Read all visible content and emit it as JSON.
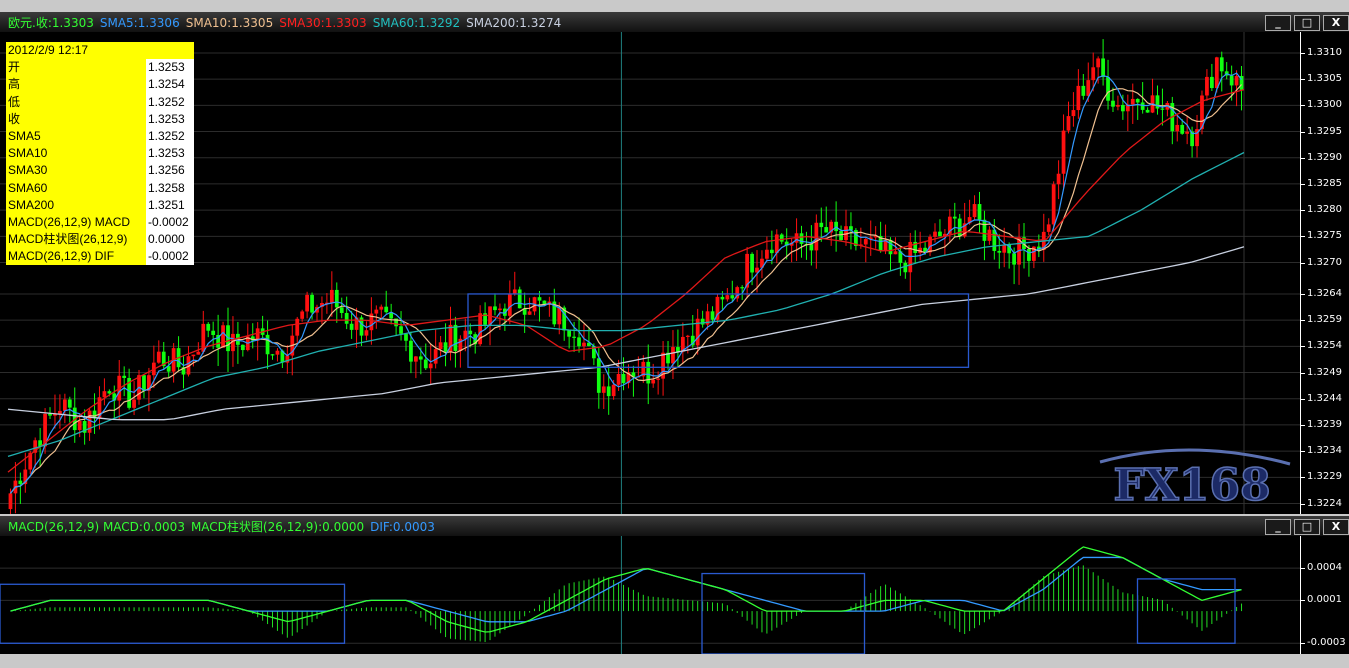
{
  "main_legend": [
    {
      "text": "欧元.收:1.3303",
      "color": "#33ff33"
    },
    {
      "text": "SMA5:1.3306",
      "color": "#3399ff"
    },
    {
      "text": "SMA10:1.3305",
      "color": "#f0c090"
    },
    {
      "text": "SMA30:1.3303",
      "color": "#ff2020"
    },
    {
      "text": "SMA60:1.3292",
      "color": "#20c0c0"
    },
    {
      "text": "SMA200:1.3274",
      "color": "#c8d0e0"
    }
  ],
  "macd_legend": [
    {
      "text": "MACD(26,12,9) MACD:0.0003",
      "color": "#33ff33"
    },
    {
      "text": "MACD柱状图(26,12,9):0.0000",
      "color": "#33ff33"
    },
    {
      "text": "DIF:0.0003",
      "color": "#3399ff"
    }
  ],
  "window_buttons": {
    "minimize": "_",
    "maximize": "□",
    "close": "X"
  },
  "info": {
    "datetime": "2012/2/9 12:17",
    "rows": [
      {
        "label": "开",
        "value": "1.3253"
      },
      {
        "label": "高",
        "value": "1.3254"
      },
      {
        "label": "低",
        "value": "1.3252"
      },
      {
        "label": "收",
        "value": "1.3253"
      },
      {
        "label": "SMA5",
        "value": "1.3252"
      },
      {
        "label": "SMA10",
        "value": "1.3253"
      },
      {
        "label": "SMA30",
        "value": "1.3256"
      },
      {
        "label": "SMA60",
        "value": "1.3258"
      },
      {
        "label": "SMA200",
        "value": "1.3251"
      },
      {
        "label": "MACD(26,12,9) MACD",
        "value": "-0.0002"
      },
      {
        "label": "MACD柱状图(26,12,9)",
        "value": "0.0000"
      },
      {
        "label": "MACD(26,12,9) DIF",
        "value": "-0.0002"
      }
    ]
  },
  "price_axis": [
    "1.3310",
    "1.3305",
    "1.3300",
    "1.3295",
    "1.3290",
    "1.3285",
    "1.3280",
    "1.3275",
    "1.3270",
    "1.3264",
    "1.3259",
    "1.3254",
    "1.3249",
    "1.3244",
    "1.3239",
    "1.3234",
    "1.3229",
    "1.3224"
  ],
  "macd_axis": [
    "0.0004",
    "0.0001",
    "-0.0003"
  ],
  "watermark": "FX168",
  "colors": {
    "up": "#ff1010",
    "down": "#10ff10",
    "sma5": "#3399ff",
    "sma10": "#f0c090",
    "sma30": "#e01818",
    "sma60": "#20b0b0",
    "sma200": "#c8d0e0",
    "box": "#2a5ad0"
  },
  "chart_data": {
    "type": "candlestick",
    "symbol": "欧元",
    "ylim": [
      1.3222,
      1.3314
    ],
    "close_path": [
      1.3226,
      1.3236,
      1.3243,
      1.3239,
      1.3247,
      1.3244,
      1.3252,
      1.325,
      1.3258,
      1.3254,
      1.3256,
      1.3253,
      1.3261,
      1.3263,
      1.3258,
      1.3259,
      1.3255,
      1.3251,
      1.3256,
      1.3257,
      1.3262,
      1.3263,
      1.326,
      1.3258,
      1.3246,
      1.325,
      1.3249,
      1.3255,
      1.3258,
      1.3262,
      1.327,
      1.3275,
      1.3273,
      1.3276,
      1.3274,
      1.3273,
      1.327,
      1.3272,
      1.3276,
      1.3279,
      1.3274,
      1.3272,
      1.3275,
      1.3298,
      1.3308,
      1.33,
      1.3302,
      1.3298,
      1.3295,
      1.3309,
      1.3303
    ],
    "sma200_path": [
      1.3242,
      1.3241,
      1.324,
      1.324,
      1.3242,
      1.3243,
      1.3244,
      1.3245,
      1.3247,
      1.3248,
      1.3249,
      1.325,
      1.3252,
      1.3254,
      1.3256,
      1.3258,
      1.326,
      1.3262,
      1.3263,
      1.3264,
      1.3266,
      1.3268,
      1.327,
      1.3273
    ],
    "sma60_path": [
      1.3233,
      1.3236,
      1.324,
      1.3244,
      1.3248,
      1.325,
      1.3253,
      1.3255,
      1.3257,
      1.3258,
      1.3258,
      1.3257,
      1.3257,
      1.3258,
      1.3259,
      1.3261,
      1.3264,
      1.3268,
      1.3271,
      1.3273,
      1.3274,
      1.3275,
      1.328,
      1.3286,
      1.3291
    ],
    "sma30_path": [
      1.323,
      1.3236,
      1.3242,
      1.3247,
      1.3251,
      1.3254,
      1.3256,
      1.3258,
      1.3259,
      1.3259,
      1.3258,
      1.3259,
      1.326,
      1.3258,
      1.3253,
      1.3254,
      1.3258,
      1.3264,
      1.3271,
      1.3274,
      1.3275,
      1.3274,
      1.3272,
      1.3274,
      1.3276,
      1.3275,
      1.3274,
      1.3283,
      1.3291,
      1.3297,
      1.3301,
      1.3303
    ],
    "macd_ylim": [
      -0.0004,
      0.0007
    ],
    "macd_path": [
      0.0,
      0.0001,
      0.0001,
      0.0001,
      0.0001,
      0.0001,
      0.0,
      -0.0001,
      0.0,
      0.0001,
      0.0001,
      -0.0001,
      -0.0002,
      -0.0001,
      0.0001,
      0.0003,
      0.0004,
      0.0003,
      0.0002,
      0.0,
      0.0,
      0.0,
      0.0001,
      0.0001,
      0.0,
      0.0,
      0.0003,
      0.0006,
      0.0005,
      0.0003,
      0.0001,
      0.0002
    ],
    "dif_path": [
      0.0,
      0.0001,
      0.0001,
      0.0001,
      0.0001,
      0.0001,
      0.0,
      0.0,
      0.0,
      0.0001,
      0.0001,
      0.0,
      -0.0001,
      -0.0001,
      0.0,
      0.0002,
      0.0004,
      0.0003,
      0.0002,
      0.0001,
      0.0,
      0.0,
      0.0,
      0.0001,
      0.0001,
      0.0,
      0.0002,
      0.0005,
      0.0005,
      0.0003,
      0.0002,
      0.0002
    ],
    "annotation_boxes": [
      {
        "pane": "price",
        "from_index": 0.36,
        "to_index": 0.745,
        "from_price": 1.3264,
        "to_price": 1.325
      },
      {
        "pane": "macd",
        "from_index": 0.0,
        "to_index": 0.265,
        "from_value": 0.00025,
        "to_value": -0.0003
      },
      {
        "pane": "macd",
        "from_index": 0.54,
        "to_index": 0.665,
        "from_value": 0.00035,
        "to_value": -0.0004
      },
      {
        "pane": "macd",
        "from_index": 0.875,
        "to_index": 0.95,
        "from_value": 0.0003,
        "to_value": -0.0003
      }
    ],
    "cursor_index": 0.478
  }
}
